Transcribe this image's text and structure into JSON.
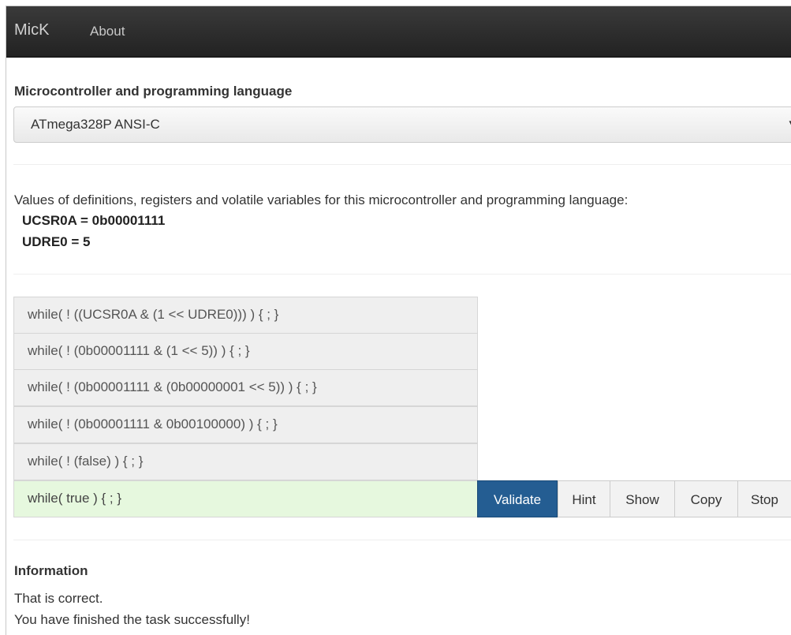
{
  "nav": {
    "brand": "MicK",
    "about": "About"
  },
  "selector": {
    "label": "Microcontroller and programming language",
    "value": "ATmega328P ANSI-C",
    "arrow": "▾"
  },
  "definitions": {
    "intro": "Values of definitions, registers and volatile variables for this microcontroller and programming language:",
    "items": [
      "UCSR0A = 0b00001111",
      "UDRE0 = 5"
    ]
  },
  "steps": [
    "while( ! ((UCSR0A & (1 << UDRE0))) ) { ; }",
    "while( ! (0b00001111 & (1 << 5)) ) { ; }",
    "while( ! (0b00001111 & (0b00000001 << 5)) ) { ; }",
    "while( ! (0b00001111 & 0b00100000) ) { ; }",
    "while( ! (false) ) { ; }",
    "while( true ) { ; }"
  ],
  "buttons": {
    "validate": "Validate",
    "hint": "Hint",
    "show": "Show",
    "copy": "Copy",
    "stop": "Stop"
  },
  "information": {
    "title": "Information",
    "lines": [
      "That is correct.",
      "You have finished the task successfully!"
    ]
  },
  "colors": {
    "navbar": "#222222",
    "primary_button": "#245d92",
    "current_step_bg": "#e6f8de"
  }
}
